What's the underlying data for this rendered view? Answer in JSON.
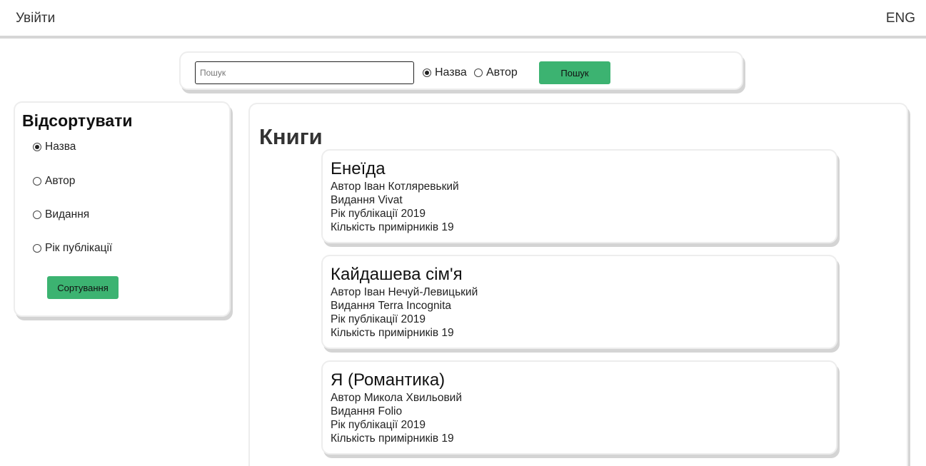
{
  "header": {
    "login": "Увійти",
    "lang": "ENG"
  },
  "search": {
    "placeholder": "Пошук",
    "value": "",
    "options": [
      {
        "label": "Назва",
        "checked": true
      },
      {
        "label": "Автор",
        "checked": false
      }
    ],
    "button": "Пошук"
  },
  "sort": {
    "title": "Відсортувати",
    "options": [
      {
        "label": "Назва",
        "checked": true
      },
      {
        "label": "Автор",
        "checked": false
      },
      {
        "label": "Видання",
        "checked": false
      },
      {
        "label": "Рік публікації",
        "checked": false
      }
    ],
    "button": "Сортування"
  },
  "books": {
    "title": "Книги",
    "items": [
      {
        "title": "Енеїда",
        "author": "Автор Іван Котляревький",
        "publisher": "Видання Vivat",
        "year": "Рік публікації 2019",
        "copies": "Кількість примірників 19"
      },
      {
        "title": "Кайдашева сім'я",
        "author": "Автор Іван Нечуй-Левицький",
        "publisher": "Видання Terra Incognita",
        "year": "Рік публікації 2019",
        "copies": "Кількість примірників 19"
      },
      {
        "title": "Я (Романтика)",
        "author": "Автор Микола Хвильовий",
        "publisher": "Видання Folio",
        "year": "Рік публікації 2019",
        "copies": "Кількість примірників 19"
      }
    ]
  },
  "colors": {
    "accent": "#3cb371",
    "border": "#d6d6d6"
  }
}
